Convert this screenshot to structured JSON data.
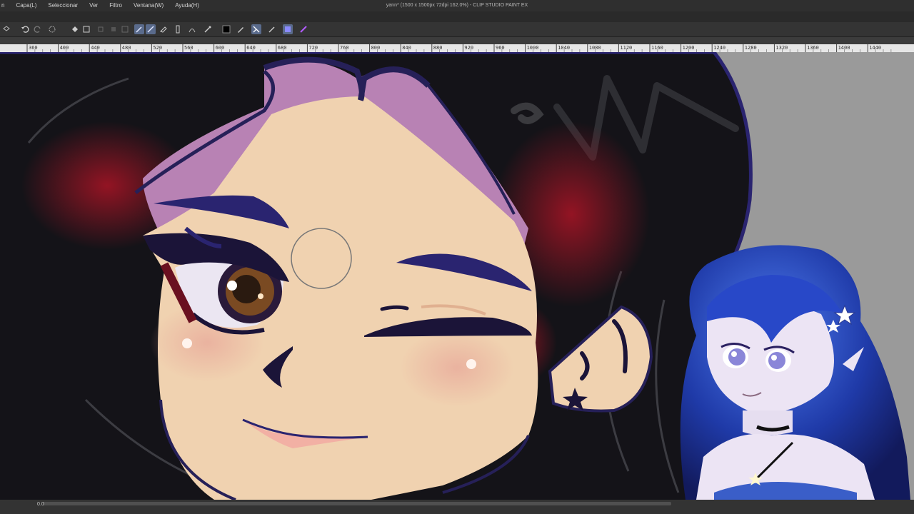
{
  "window": {
    "title": "yann* (1500 x 1500px 72dpi 162.0%) - CLIP STUDIO PAINT EX"
  },
  "menu": [
    {
      "label": "n"
    },
    {
      "label": "Capa(L)"
    },
    {
      "label": "Seleccionar"
    },
    {
      "label": "Ver"
    },
    {
      "label": "Filtro"
    },
    {
      "label": "Ventana(W)"
    },
    {
      "label": "Ayuda(H)"
    }
  ],
  "ruler": {
    "labels": [
      "360",
      "400",
      "440",
      "480",
      "520",
      "560",
      "600",
      "640",
      "680",
      "720",
      "760",
      "800",
      "840",
      "880",
      "920",
      "960",
      "1000",
      "1040",
      "1080",
      "1120",
      "1160",
      "1200",
      "1240",
      "1280",
      "1320",
      "1360",
      "1400",
      "1440"
    ]
  },
  "status": {
    "zoom_value": "0.0"
  },
  "colors": {
    "hair_dark": "#141318",
    "hair_red": "#7a1420",
    "skin": "#f0d2b0",
    "purple": "#b882b4",
    "navy": "#262058",
    "avatar_blue": "#2846c8"
  },
  "icons": [
    "undo-icon",
    "redo-icon",
    "lasso-icon",
    "fill-icon",
    "transform-icon",
    "pen-icon",
    "eraser-icon",
    "eyedropper-icon",
    "color-swatch-icon"
  ]
}
